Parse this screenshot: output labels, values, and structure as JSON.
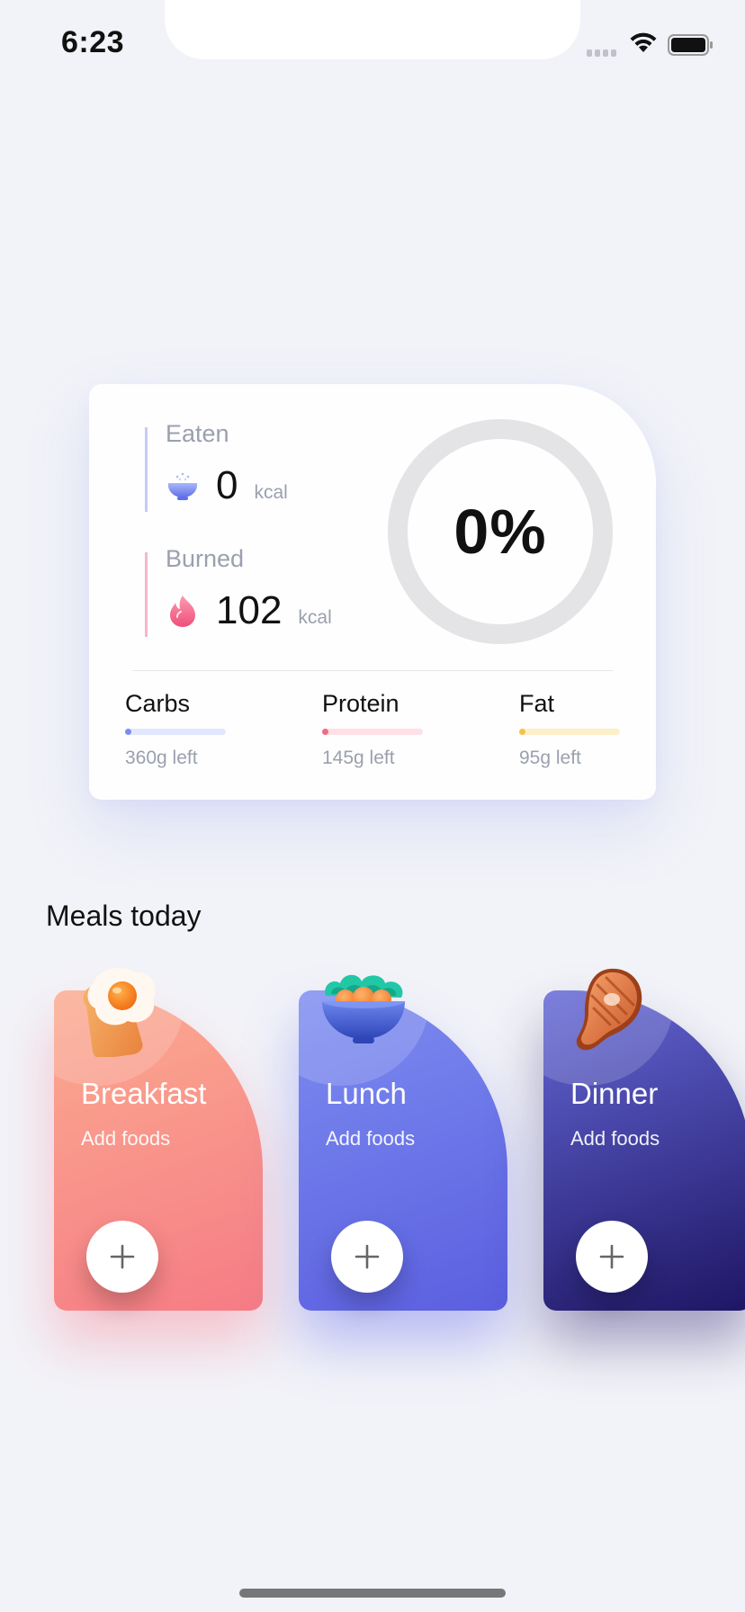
{
  "status_bar": {
    "time": "6:23",
    "icons": [
      "signal-icon",
      "wifi-icon",
      "battery-icon"
    ]
  },
  "summary": {
    "eaten": {
      "label": "Eaten",
      "value": "0",
      "unit": "kcal",
      "icon": "rice-bowl-icon"
    },
    "burned": {
      "label": "Burned",
      "value": "102",
      "unit": "kcal",
      "icon": "flame-icon"
    },
    "progress": {
      "text": "0%",
      "fraction": 0
    },
    "macros": [
      {
        "name": "Carbs",
        "left": "360g left",
        "color": "#7b8cf2",
        "track": "#e3e7fd",
        "fraction": 0.04
      },
      {
        "name": "Protein",
        "left": "145g left",
        "color": "#f36a86",
        "track": "#fde1e7",
        "fraction": 0.04
      },
      {
        "name": "Fat",
        "left": "95g left",
        "color": "#f5c34a",
        "track": "#fdf0c9",
        "fraction": 0.04
      }
    ]
  },
  "meals": {
    "title": "Meals today",
    "items": [
      {
        "title": "Breakfast",
        "subtitle": "Add foods",
        "icon": "fried-egg-toast-icon",
        "action": "add-icon"
      },
      {
        "title": "Lunch",
        "subtitle": "Add foods",
        "icon": "salad-bowl-icon",
        "action": "add-icon"
      },
      {
        "title": "Dinner",
        "subtitle": "Add foods",
        "icon": "steak-icon",
        "action": "add-icon"
      }
    ]
  },
  "colors": {
    "background": "#f2f3f8",
    "breakfast_gradient": [
      "#fbab90",
      "#f67c85"
    ],
    "lunch_gradient": [
      "#7d8df0",
      "#5b5fe0"
    ],
    "dinner_gradient": [
      "#6467d6",
      "#1e1664"
    ],
    "ring_track": "#e4e4e7"
  }
}
